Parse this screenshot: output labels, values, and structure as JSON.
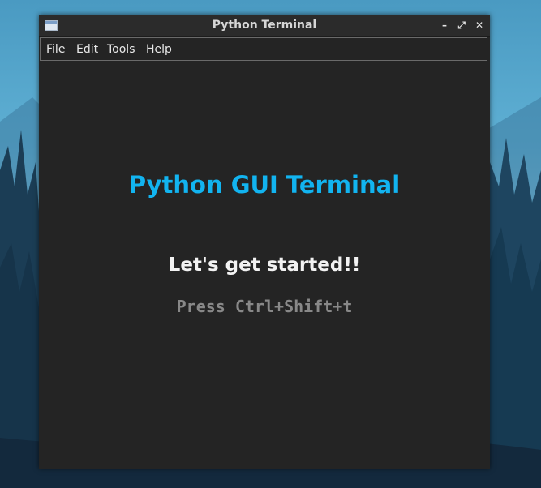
{
  "window": {
    "title": "Python Terminal",
    "controls": {
      "minimize": "–",
      "maximize": "⤢",
      "close": "✕"
    }
  },
  "menu": {
    "items": [
      "File",
      "Edit",
      "Tools",
      "Help"
    ]
  },
  "main": {
    "heading": "Python GUI Terminal",
    "subheading": "Let's get started!!",
    "shortcut_hint": "Press Ctrl+Shift+t"
  },
  "colors": {
    "heading": "#12b4f0",
    "window_bg": "#242424"
  }
}
